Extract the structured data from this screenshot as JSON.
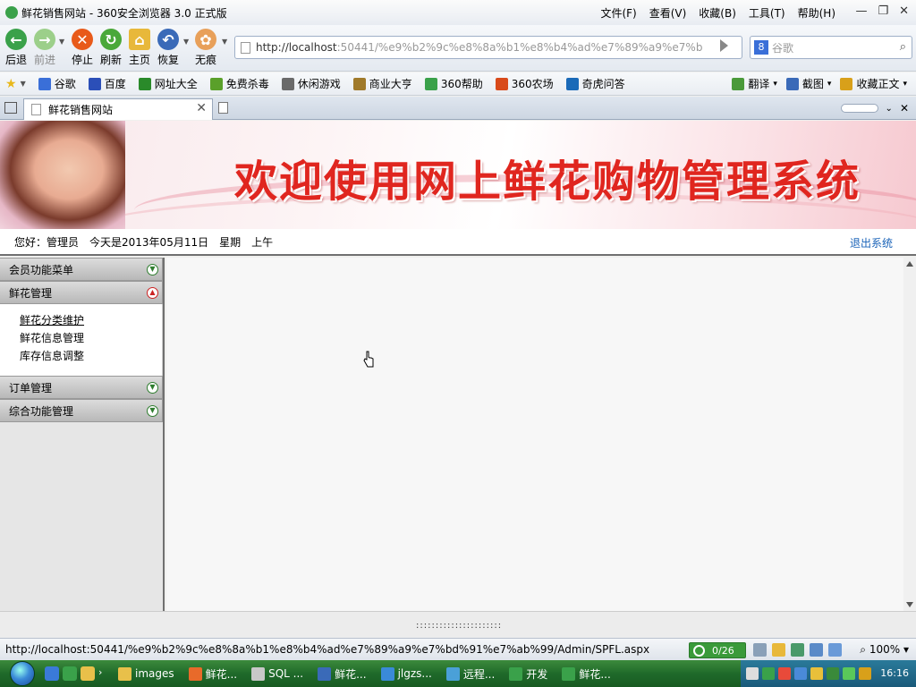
{
  "window": {
    "title": "鲜花销售网站 - 360安全浏览器 3.0 正式版",
    "menu": [
      "文件(F)",
      "查看(V)",
      "收藏(B)",
      "工具(T)",
      "帮助(H)"
    ],
    "controls": [
      "—",
      "❐",
      "✕"
    ]
  },
  "toolbar": {
    "back": "后退",
    "forward": "前进",
    "stop": "停止",
    "refresh": "刷新",
    "home": "主页",
    "restore": "恢复",
    "incognito": "无痕",
    "url_host": "http://localhost",
    "url_rest": ":50441/%e9%b2%9c%e8%8a%b1%e8%b4%ad%e7%89%a9%e7%bd%",
    "search_engine": "8",
    "search_placeholder": "谷歌"
  },
  "favorites": [
    {
      "label": "谷歌",
      "color": "#3a6fd8"
    },
    {
      "label": "百度",
      "color": "#2b4fb8"
    },
    {
      "label": "网址大全",
      "color": "#2a8a2a"
    },
    {
      "label": "免费杀毒",
      "color": "#5aa02a"
    },
    {
      "label": "休闲游戏",
      "color": "#6a6a6a"
    },
    {
      "label": "商业大亨",
      "color": "#a07a2a"
    },
    {
      "label": "360帮助",
      "color": "#3aa14a"
    },
    {
      "label": "360农场",
      "color": "#d84a1a"
    },
    {
      "label": "奇虎问答",
      "color": "#1a6ab8"
    }
  ],
  "favorites_right": [
    {
      "label": "翻译",
      "color": "#4a9a3a"
    },
    {
      "label": "截图",
      "color": "#3a6ab8"
    },
    {
      "label": "收藏正文",
      "color": "#d8a01a"
    }
  ],
  "tab": {
    "title": "鲜花销售网站"
  },
  "page": {
    "banner_title": "欢迎使用网上鲜花购物管理系统",
    "greeting": "您好：管理员",
    "today": "今天是2013年05月11日",
    "weekday": "星期",
    "period": "上午",
    "logout": "退出系统"
  },
  "menu": {
    "member": "会员功能菜单",
    "flower": "鲜花管理",
    "flower_items": [
      "鲜花分类维护",
      "鲜花信息管理",
      "库存信息调整"
    ],
    "orders": "订单管理",
    "general": "综合功能管理"
  },
  "footer": {
    "splitter": "::::::::::::::::::::::"
  },
  "status": {
    "url": "http://localhost:50441/%e9%b2%9c%e8%8a%b1%e8%b4%ad%e7%89%a9%e7%bd%91%e7%ab%99/Admin/SPFL.aspx",
    "progress": "0/26",
    "zoom": "100%"
  },
  "taskbar": {
    "tasks": [
      {
        "label": "images",
        "color": "#e8c04a"
      },
      {
        "label": "鲜花...",
        "color": "#e86a2a"
      },
      {
        "label": "SQL ...",
        "color": "#c8c8c8"
      },
      {
        "label": "鲜花...",
        "color": "#3a6ab8"
      },
      {
        "label": "jlgzs...",
        "color": "#3a8ad8"
      },
      {
        "label": "远程...",
        "color": "#4aa0d8"
      },
      {
        "label": "开发",
        "color": "#3aa14a"
      },
      {
        "label": "鲜花...",
        "color": "#3aa14a"
      }
    ],
    "clock": "16:16"
  }
}
